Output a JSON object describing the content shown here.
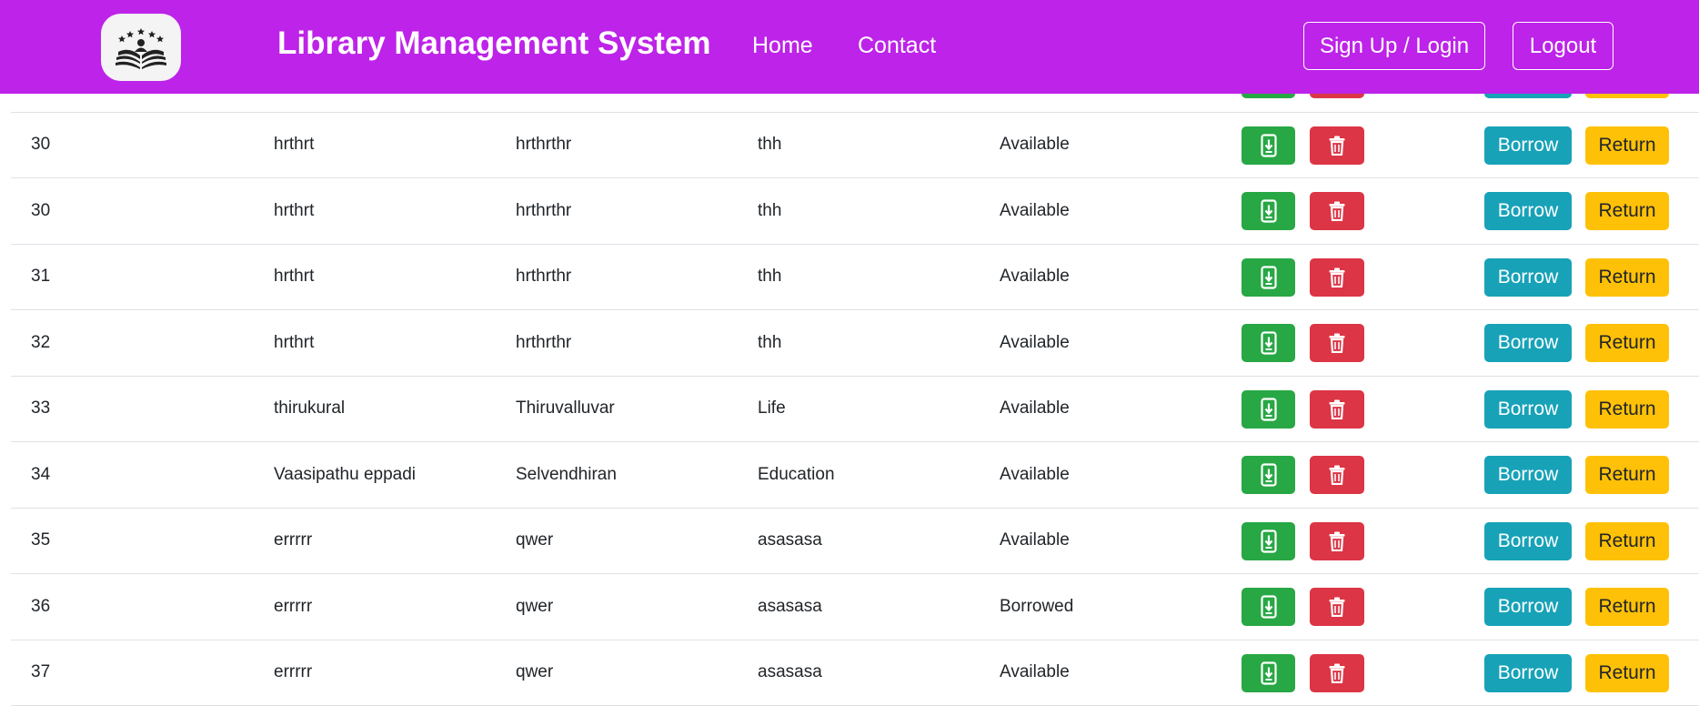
{
  "header": {
    "brand": "Library Management System",
    "nav": {
      "home": "Home",
      "contact": "Contact"
    },
    "signup_label": "Sign Up / Login",
    "logout_label": "Logout",
    "background": "#bd23e8"
  },
  "actions": {
    "borrow_label": "Borrow",
    "return_label": "Return",
    "download_icon": "download-icon",
    "delete_icon": "trash-icon",
    "colors": {
      "download": "#28a745",
      "delete": "#dc3545",
      "borrow": "#17a2b8",
      "return": "#ffc107"
    }
  },
  "books": [
    {
      "id": "",
      "title": "",
      "author": "",
      "genre": "",
      "status": ""
    },
    {
      "id": "30",
      "title": "hrthrt",
      "author": "hrthrthr",
      "genre": "thh",
      "status": "Available"
    },
    {
      "id": "30",
      "title": "hrthrt",
      "author": "hrthrthr",
      "genre": "thh",
      "status": "Available"
    },
    {
      "id": "31",
      "title": "hrthrt",
      "author": "hrthrthr",
      "genre": "thh",
      "status": "Available"
    },
    {
      "id": "32",
      "title": "hrthrt",
      "author": "hrthrthr",
      "genre": "thh",
      "status": "Available"
    },
    {
      "id": "33",
      "title": "thirukural",
      "author": "Thiruvalluvar",
      "genre": "Life",
      "status": "Available"
    },
    {
      "id": "34",
      "title": "Vaasipathu eppadi",
      "author": "Selvendhiran",
      "genre": "Education",
      "status": "Available"
    },
    {
      "id": "35",
      "title": "errrrr",
      "author": "qwer",
      "genre": "asasasa",
      "status": "Available"
    },
    {
      "id": "36",
      "title": "errrrr",
      "author": "qwer",
      "genre": "asasasa",
      "status": "Borrowed"
    },
    {
      "id": "37",
      "title": "errrrr",
      "author": "qwer",
      "genre": "asasasa",
      "status": "Available"
    }
  ]
}
